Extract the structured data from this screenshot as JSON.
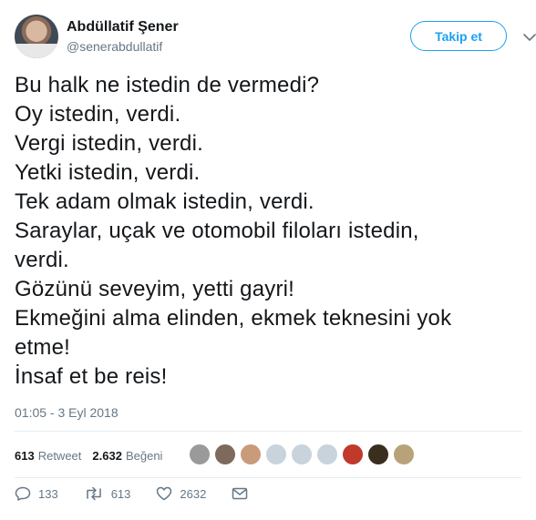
{
  "user": {
    "name": "Abdüllatif Şener",
    "handle": "@senerabdullatif"
  },
  "follow_label": "Takip et",
  "tweet_lines": [
    "Bu halk ne istedin de vermedi?",
    "Oy istedin, verdi.",
    "Vergi istedin, verdi.",
    "Yetki istedin, verdi.",
    "Tek adam olmak istedin, verdi.",
    "Saraylar, uçak ve otomobil filoları istedin,",
    "verdi.",
    "Gözünü seveyim, yetti gayri!",
    "Ekmeğini alma elinden, ekmek teknesini yok",
    "etme!",
    "İnsaf et be reis!"
  ],
  "timestamp": "01:05 - 3 Eyl 2018",
  "stats": {
    "retweet_count": "613",
    "retweet_label": "Retweet",
    "like_count": "2.632",
    "like_label": "Beğeni"
  },
  "faces": [
    {
      "color": "#9a9a9a"
    },
    {
      "color": "#7d6a5c"
    },
    {
      "color": "#c89b7b"
    },
    {
      "color": "#c8d3dc"
    },
    {
      "color": "#c8d3dc"
    },
    {
      "color": "#c8d3dc"
    },
    {
      "color": "#c0392b"
    },
    {
      "color": "#3a2e1f"
    },
    {
      "color": "#b8a27a"
    }
  ],
  "actions": {
    "reply_count": "133",
    "retweet_count": "613",
    "like_count": "2632"
  },
  "colors": {
    "accent": "#1da1f2",
    "muted": "#657786",
    "text": "#14171a"
  }
}
